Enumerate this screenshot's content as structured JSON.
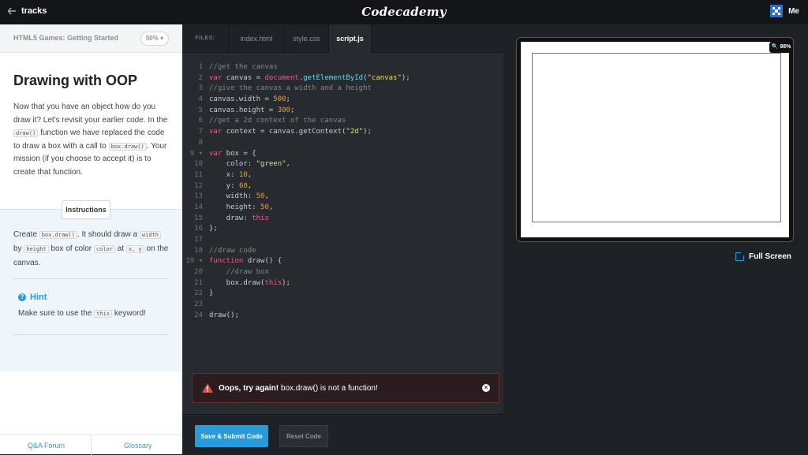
{
  "topbar": {
    "back_label": "tracks",
    "logo": "Codecademy",
    "user_label": "Me"
  },
  "lesson": {
    "course_title": "HTML5 Games: Getting Started",
    "progress_percent": "50%",
    "title": "Drawing with OOP",
    "intro_1": "Now that you have an object how do you draw it? Let's revisit your earlier code. In the",
    "code_draw": "draw()",
    "intro_2": "function we have replaced the code to draw a box with a call to",
    "code_boxdraw": "box.draw()",
    "intro_3": ". Your mission (if you choose to accept it) is to create that function.",
    "instructions_label": "Instructions",
    "instr_1": "Create",
    "instr_code_boxdraw": "box.draw()",
    "instr_2": ". It should draw a",
    "instr_code_width": "width",
    "instr_3": "by",
    "instr_code_height": "height",
    "instr_4": "box of color",
    "instr_code_color": "color",
    "instr_5": "at",
    "instr_code_xy": "x, y",
    "instr_6": "on the canvas.",
    "hint_title": "Hint",
    "hint_1": "Make sure to use the",
    "hint_code": "this",
    "hint_2": "keyword!",
    "footer_qa": "Q&A Forum",
    "footer_glossary": "Glossary"
  },
  "editor": {
    "files_label": "FILES:",
    "tabs": [
      "index.html",
      "style.css",
      "script.js"
    ],
    "active_tab": "script.js",
    "error_title": "Oops, try again!",
    "error_message": "box.draw() is not a function!",
    "submit_label": "Save & Submit Code",
    "reset_label": "Reset Code"
  },
  "code_lines": [
    "//get the canvas",
    "var canvas = document.getElementById(\"canvas\");",
    "//give the canvas a width and a height",
    "canvas.width = 500;",
    "canvas.height = 300;",
    "//get a 2d context of the canvas",
    "var context = canvas.getContext(\"2d\");",
    "",
    "var box = {",
    "    color: \"green\",",
    "    x: 10,",
    "    y: 60,",
    "    width: 50,",
    "    height: 50,",
    "    draw: this",
    "};",
    "",
    "//draw code",
    "function draw() {",
    "    //draw box",
    "    box.draw(this);",
    "}",
    "",
    "draw();"
  ],
  "preview": {
    "zoom_label": "98%",
    "fullscreen_label": "Full Screen"
  },
  "colors": {
    "accent": "#2a9bd9",
    "error_bg": "#2b1d1f",
    "editor_bg": "#272b30"
  }
}
